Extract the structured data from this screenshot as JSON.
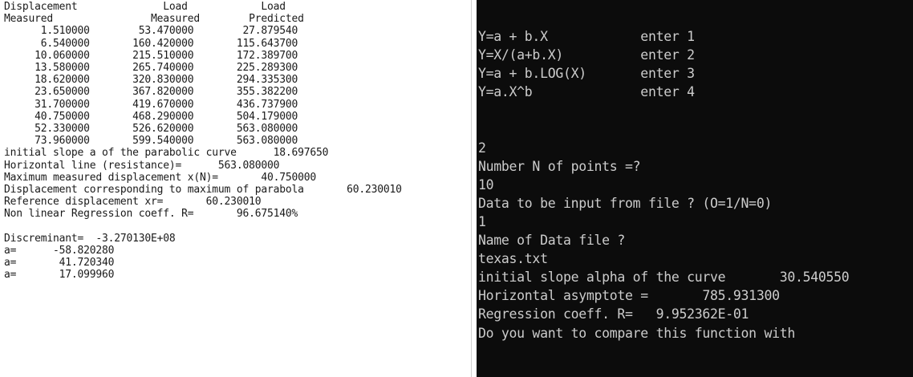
{
  "left": {
    "lines": [
      "Displacement              Load            Load",
      "Measured                Measured        Predicted",
      "      1.510000        53.470000        27.879540",
      "      6.540000       160.420000       115.643700",
      "     10.060000       215.510000       172.389700",
      "     13.580000       265.740000       225.289300",
      "     18.620000       320.830000       294.335300",
      "     23.650000       367.820000       355.382200",
      "     31.700000       419.670000       436.737900",
      "     40.750000       468.290000       504.179000",
      "     52.330000       526.620000       563.080000",
      "     73.960000       599.540000       563.080000",
      "initial slope a of the parabolic curve      18.697650",
      "Horizontal line (resistance)=      563.080000",
      "Maximum measured displacement x(N)=       40.750000",
      "Displacement corresponding to maximum of parabola       60.230010",
      "Reference displacement xr=       60.230010",
      "Non linear Regression coeff. R=       96.675140%",
      "",
      "Discreminant=  -3.270130E+08",
      "a=      -58.820280",
      "a=       41.720340",
      "a=       17.099960"
    ]
  },
  "right": {
    "lines": [
      "Y=a + b.X            enter 1",
      "Y=X/(a+b.X)          enter 2",
      "Y=a + b.LOG(X)       enter 3",
      "Y=a.X^b              enter 4",
      "",
      "",
      "2",
      "Number N of points =?",
      "10",
      "Data to be input from file ? (O=1/N=0)",
      "1",
      "Name of Data file ?",
      "texas.txt",
      "initial slope alpha of the curve       30.540550",
      "Horizontal asymptote =       785.931300",
      "Regression coeff. R=   9.952362E-01",
      "Do you want to compare this function with"
    ]
  }
}
